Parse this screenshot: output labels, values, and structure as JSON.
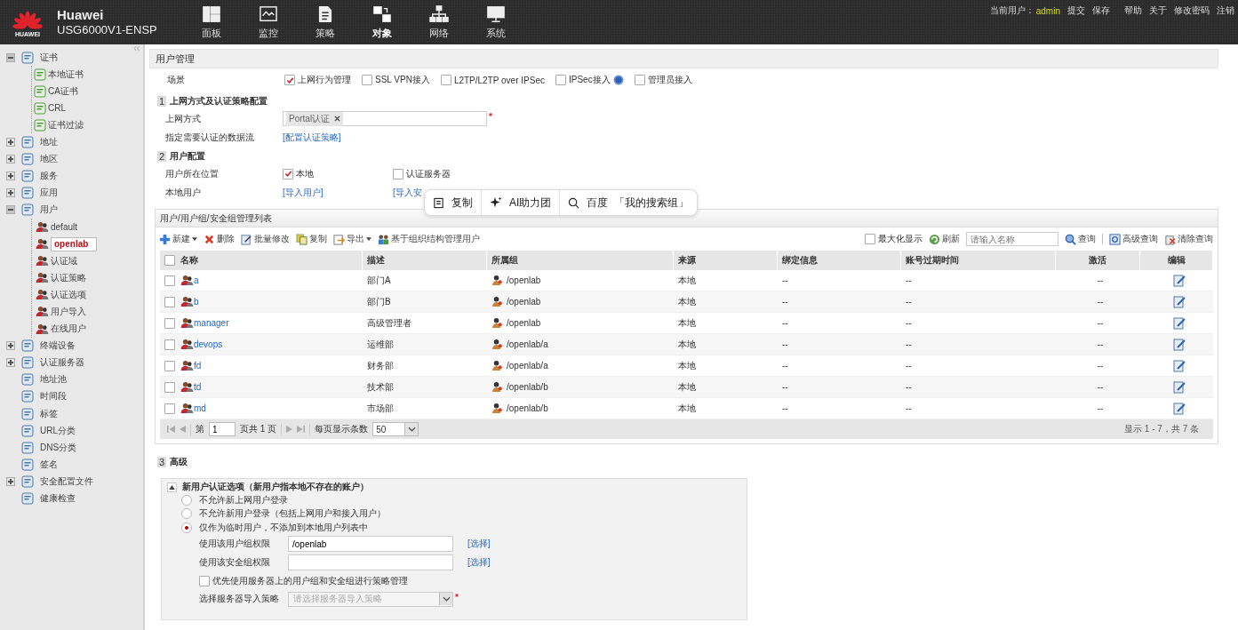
{
  "header": {
    "brand": "HUAWEI",
    "product": "Huawei",
    "model": "USG6000V1-ENSP",
    "nav": [
      {
        "label": "面板",
        "selected": false
      },
      {
        "label": "监控",
        "selected": false
      },
      {
        "label": "策略",
        "selected": false
      },
      {
        "label": "对象",
        "selected": true
      },
      {
        "label": "网络",
        "selected": false
      },
      {
        "label": "系统",
        "selected": false
      }
    ],
    "user_label": "当前用户：",
    "user": "admin",
    "links": [
      "提交",
      "保存",
      "帮助",
      "关于",
      "修改密码",
      "注销"
    ]
  },
  "sidebar": {
    "items": [
      {
        "label": "证书",
        "expanded": true,
        "selected": false,
        "children": [
          {
            "label": "本地证书",
            "selected": false
          },
          {
            "label": "CA证书",
            "selected": false
          },
          {
            "label": "CRL",
            "selected": false
          },
          {
            "label": "证书过滤",
            "selected": false
          }
        ]
      },
      {
        "label": "地址",
        "expanded": false,
        "selected": false
      },
      {
        "label": "地区",
        "expanded": false,
        "selected": false
      },
      {
        "label": "服务",
        "expanded": false,
        "selected": false
      },
      {
        "label": "应用",
        "expanded": false,
        "selected": false
      },
      {
        "label": "用户",
        "expanded": true,
        "selected": false,
        "children": [
          {
            "label": "default",
            "selected": false
          },
          {
            "label": "openlab",
            "selected": true
          },
          {
            "label": "认证域",
            "selected": false
          },
          {
            "label": "认证策略",
            "selected": false
          },
          {
            "label": "认证选项",
            "selected": false
          },
          {
            "label": "用户导入",
            "selected": false
          },
          {
            "label": "在线用户",
            "selected": false
          }
        ]
      },
      {
        "label": "终端设备",
        "expanded": false,
        "selected": false
      },
      {
        "label": "认证服务器",
        "expanded": false,
        "selected": false
      },
      {
        "label": "地址池",
        "selected": false
      },
      {
        "label": "时间段",
        "selected": false
      },
      {
        "label": "标签",
        "selected": false
      },
      {
        "label": "URL分类",
        "selected": false
      },
      {
        "label": "DNS分类",
        "selected": false
      },
      {
        "label": "签名",
        "selected": false
      },
      {
        "label": "安全配置文件",
        "expanded": false,
        "selected": false
      },
      {
        "label": "健康检查",
        "selected": false
      }
    ]
  },
  "page": {
    "title": "用户管理",
    "scenario": {
      "label": "场景",
      "options": [
        {
          "label": "上网行为管理",
          "checked": true
        },
        {
          "label": "SSL VPN接入",
          "checked": false
        },
        {
          "label": "L2TP/L2TP over IPSec",
          "checked": false
        },
        {
          "label": "IPSec接入",
          "checked": false,
          "help": true
        },
        {
          "label": "管理员接入",
          "checked": false
        }
      ]
    },
    "section_1": {
      "number": "1",
      "title": "上网方式及认证策略配置",
      "access_label": "上网方式",
      "access_tags": [
        "Portal认证"
      ],
      "access_required": true,
      "flow_label": "指定需要认证的数据流",
      "flow_link": "[配置认证策略]"
    },
    "section_2": {
      "number": "2",
      "title": "用户配置",
      "location_label": "用户所在位置",
      "location_options": [
        {
          "label": "本地",
          "checked": true
        },
        {
          "label": "认证服务器",
          "checked": false
        }
      ],
      "local_label": "本地用户",
      "local_links": [
        "[导入用户]",
        "[导入安"
      ]
    },
    "popup": {
      "items": [
        {
          "kind": "copy",
          "label": "复制"
        },
        {
          "kind": "ai",
          "label": "AI助力团"
        },
        {
          "kind": "search",
          "label": "百度  「我的搜索组」"
        }
      ]
    },
    "table_panel": {
      "title": "用户/用户组/安全组管理列表",
      "tools": [
        {
          "kind": "add",
          "label": "新建",
          "dropdown": true
        },
        {
          "kind": "delete",
          "label": "删除",
          "dropdown": false
        },
        {
          "kind": "edit",
          "label": "批量修改",
          "dropdown": false
        },
        {
          "kind": "copy",
          "label": "复制",
          "dropdown": false
        },
        {
          "kind": "export",
          "label": "导出",
          "dropdown": true
        },
        {
          "kind": "org",
          "label": "基于组织结构管理用户",
          "dropdown": false
        }
      ],
      "select_all_checked": false,
      "maximize": {
        "label": "最大化显示",
        "checked": false
      },
      "refresh": "刷新",
      "search_placeholder": "请输入名称",
      "query": "查询",
      "advanced_query": "高级查询",
      "clear_query": "清除查询",
      "columns": [
        "名称",
        "描述",
        "所属组",
        "来源",
        "绑定信息",
        "账号过期时间",
        "激活",
        "编辑"
      ],
      "rows": [
        {
          "checked": false,
          "name": "a",
          "description": "部门A",
          "group": "/openlab",
          "source": "本地",
          "binding": "--",
          "expiry": "--",
          "active": "--"
        },
        {
          "checked": false,
          "name": "b",
          "description": "部门B",
          "group": "/openlab",
          "source": "本地",
          "binding": "--",
          "expiry": "--",
          "active": "--"
        },
        {
          "checked": false,
          "name": "manager",
          "description": "高级管理者",
          "group": "/openlab",
          "source": "本地",
          "binding": "--",
          "expiry": "--",
          "active": "--"
        },
        {
          "checked": false,
          "name": "devops",
          "description": "运维部",
          "group": "/openlab/a",
          "source": "本地",
          "binding": "--",
          "expiry": "--",
          "active": "--"
        },
        {
          "checked": false,
          "name": "fd",
          "description": "财务部",
          "group": "/openlab/a",
          "source": "本地",
          "binding": "--",
          "expiry": "--",
          "active": "--"
        },
        {
          "checked": false,
          "name": "td",
          "description": "技术部",
          "group": "/openlab/b",
          "source": "本地",
          "binding": "--",
          "expiry": "--",
          "active": "--"
        },
        {
          "checked": false,
          "name": "md",
          "description": "市场部",
          "group": "/openlab/b",
          "source": "本地",
          "binding": "--",
          "expiry": "--",
          "active": "--"
        }
      ],
      "pager": {
        "page_prefix": "第",
        "page": "1",
        "page_suffix": "页共 1 页",
        "per_page_label": "每页显示条数",
        "per_page": "50",
        "summary": "显示 1 - 7，共 7 条"
      }
    },
    "section_3": {
      "number": "3",
      "title": "高级",
      "box": {
        "title": "新用户认证选项（新用户指本地不存在的账户）",
        "expanded": true,
        "radios": [
          {
            "label": "不允许新上网用户登录",
            "selected": false
          },
          {
            "label": "不允许新用户登录（包括上网用户和接入用户）",
            "selected": false
          },
          {
            "label": "仅作为临时用户，不添加到本地用户列表中",
            "selected": true
          }
        ],
        "user_group_label": "使用该用户组权限",
        "user_group_value": "/openlab",
        "user_group_link": "[选择]",
        "security_group_label": "使用该安全组权限",
        "security_group_link": "[选择]",
        "prefer_label": "优先使用服务器上的用户组和安全组进行策略管理",
        "prefer_checked": false,
        "import_label": "选择服务器导入策略",
        "import_placeholder": "请选择服务器导入策略",
        "import_disabled": true,
        "import_required": true
      }
    }
  }
}
